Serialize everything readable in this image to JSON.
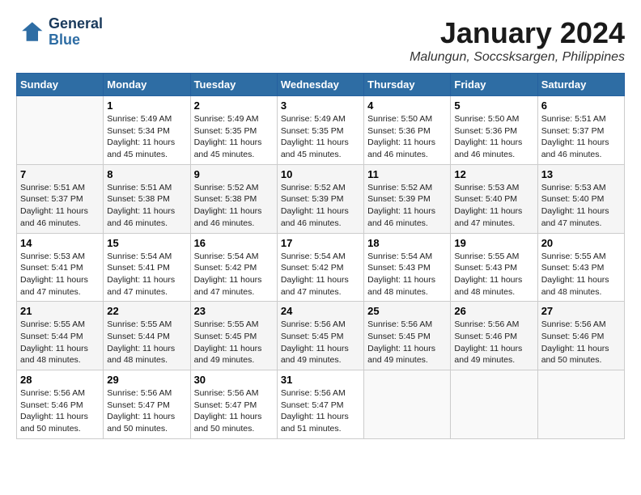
{
  "header": {
    "logo_general": "General",
    "logo_blue": "Blue",
    "month": "January 2024",
    "location": "Malungun, Soccsksargen, Philippines"
  },
  "days_of_week": [
    "Sunday",
    "Monday",
    "Tuesday",
    "Wednesday",
    "Thursday",
    "Friday",
    "Saturday"
  ],
  "weeks": [
    [
      {
        "day": "",
        "sunrise": "",
        "sunset": "",
        "daylight": ""
      },
      {
        "day": "1",
        "sunrise": "Sunrise: 5:49 AM",
        "sunset": "Sunset: 5:34 PM",
        "daylight": "Daylight: 11 hours and 45 minutes."
      },
      {
        "day": "2",
        "sunrise": "Sunrise: 5:49 AM",
        "sunset": "Sunset: 5:35 PM",
        "daylight": "Daylight: 11 hours and 45 minutes."
      },
      {
        "day": "3",
        "sunrise": "Sunrise: 5:49 AM",
        "sunset": "Sunset: 5:35 PM",
        "daylight": "Daylight: 11 hours and 45 minutes."
      },
      {
        "day": "4",
        "sunrise": "Sunrise: 5:50 AM",
        "sunset": "Sunset: 5:36 PM",
        "daylight": "Daylight: 11 hours and 46 minutes."
      },
      {
        "day": "5",
        "sunrise": "Sunrise: 5:50 AM",
        "sunset": "Sunset: 5:36 PM",
        "daylight": "Daylight: 11 hours and 46 minutes."
      },
      {
        "day": "6",
        "sunrise": "Sunrise: 5:51 AM",
        "sunset": "Sunset: 5:37 PM",
        "daylight": "Daylight: 11 hours and 46 minutes."
      }
    ],
    [
      {
        "day": "7",
        "sunrise": "Sunrise: 5:51 AM",
        "sunset": "Sunset: 5:37 PM",
        "daylight": "Daylight: 11 hours and 46 minutes."
      },
      {
        "day": "8",
        "sunrise": "Sunrise: 5:51 AM",
        "sunset": "Sunset: 5:38 PM",
        "daylight": "Daylight: 11 hours and 46 minutes."
      },
      {
        "day": "9",
        "sunrise": "Sunrise: 5:52 AM",
        "sunset": "Sunset: 5:38 PM",
        "daylight": "Daylight: 11 hours and 46 minutes."
      },
      {
        "day": "10",
        "sunrise": "Sunrise: 5:52 AM",
        "sunset": "Sunset: 5:39 PM",
        "daylight": "Daylight: 11 hours and 46 minutes."
      },
      {
        "day": "11",
        "sunrise": "Sunrise: 5:52 AM",
        "sunset": "Sunset: 5:39 PM",
        "daylight": "Daylight: 11 hours and 46 minutes."
      },
      {
        "day": "12",
        "sunrise": "Sunrise: 5:53 AM",
        "sunset": "Sunset: 5:40 PM",
        "daylight": "Daylight: 11 hours and 47 minutes."
      },
      {
        "day": "13",
        "sunrise": "Sunrise: 5:53 AM",
        "sunset": "Sunset: 5:40 PM",
        "daylight": "Daylight: 11 hours and 47 minutes."
      }
    ],
    [
      {
        "day": "14",
        "sunrise": "Sunrise: 5:53 AM",
        "sunset": "Sunset: 5:41 PM",
        "daylight": "Daylight: 11 hours and 47 minutes."
      },
      {
        "day": "15",
        "sunrise": "Sunrise: 5:54 AM",
        "sunset": "Sunset: 5:41 PM",
        "daylight": "Daylight: 11 hours and 47 minutes."
      },
      {
        "day": "16",
        "sunrise": "Sunrise: 5:54 AM",
        "sunset": "Sunset: 5:42 PM",
        "daylight": "Daylight: 11 hours and 47 minutes."
      },
      {
        "day": "17",
        "sunrise": "Sunrise: 5:54 AM",
        "sunset": "Sunset: 5:42 PM",
        "daylight": "Daylight: 11 hours and 47 minutes."
      },
      {
        "day": "18",
        "sunrise": "Sunrise: 5:54 AM",
        "sunset": "Sunset: 5:43 PM",
        "daylight": "Daylight: 11 hours and 48 minutes."
      },
      {
        "day": "19",
        "sunrise": "Sunrise: 5:55 AM",
        "sunset": "Sunset: 5:43 PM",
        "daylight": "Daylight: 11 hours and 48 minutes."
      },
      {
        "day": "20",
        "sunrise": "Sunrise: 5:55 AM",
        "sunset": "Sunset: 5:43 PM",
        "daylight": "Daylight: 11 hours and 48 minutes."
      }
    ],
    [
      {
        "day": "21",
        "sunrise": "Sunrise: 5:55 AM",
        "sunset": "Sunset: 5:44 PM",
        "daylight": "Daylight: 11 hours and 48 minutes."
      },
      {
        "day": "22",
        "sunrise": "Sunrise: 5:55 AM",
        "sunset": "Sunset: 5:44 PM",
        "daylight": "Daylight: 11 hours and 48 minutes."
      },
      {
        "day": "23",
        "sunrise": "Sunrise: 5:55 AM",
        "sunset": "Sunset: 5:45 PM",
        "daylight": "Daylight: 11 hours and 49 minutes."
      },
      {
        "day": "24",
        "sunrise": "Sunrise: 5:56 AM",
        "sunset": "Sunset: 5:45 PM",
        "daylight": "Daylight: 11 hours and 49 minutes."
      },
      {
        "day": "25",
        "sunrise": "Sunrise: 5:56 AM",
        "sunset": "Sunset: 5:45 PM",
        "daylight": "Daylight: 11 hours and 49 minutes."
      },
      {
        "day": "26",
        "sunrise": "Sunrise: 5:56 AM",
        "sunset": "Sunset: 5:46 PM",
        "daylight": "Daylight: 11 hours and 49 minutes."
      },
      {
        "day": "27",
        "sunrise": "Sunrise: 5:56 AM",
        "sunset": "Sunset: 5:46 PM",
        "daylight": "Daylight: 11 hours and 50 minutes."
      }
    ],
    [
      {
        "day": "28",
        "sunrise": "Sunrise: 5:56 AM",
        "sunset": "Sunset: 5:46 PM",
        "daylight": "Daylight: 11 hours and 50 minutes."
      },
      {
        "day": "29",
        "sunrise": "Sunrise: 5:56 AM",
        "sunset": "Sunset: 5:47 PM",
        "daylight": "Daylight: 11 hours and 50 minutes."
      },
      {
        "day": "30",
        "sunrise": "Sunrise: 5:56 AM",
        "sunset": "Sunset: 5:47 PM",
        "daylight": "Daylight: 11 hours and 50 minutes."
      },
      {
        "day": "31",
        "sunrise": "Sunrise: 5:56 AM",
        "sunset": "Sunset: 5:47 PM",
        "daylight": "Daylight: 11 hours and 51 minutes."
      },
      {
        "day": "",
        "sunrise": "",
        "sunset": "",
        "daylight": ""
      },
      {
        "day": "",
        "sunrise": "",
        "sunset": "",
        "daylight": ""
      },
      {
        "day": "",
        "sunrise": "",
        "sunset": "",
        "daylight": ""
      }
    ]
  ]
}
